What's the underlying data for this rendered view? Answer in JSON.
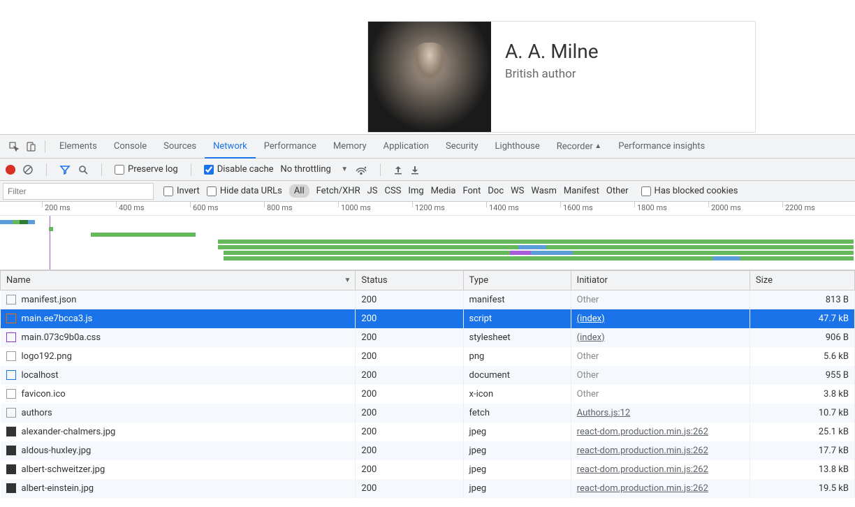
{
  "page": {
    "card_title": "A. A. Milne",
    "card_subtitle": "British author"
  },
  "devtools": {
    "tabs": [
      "Elements",
      "Console",
      "Sources",
      "Network",
      "Performance",
      "Memory",
      "Application",
      "Security",
      "Lighthouse",
      "Recorder",
      "Performance insights"
    ],
    "active_tab": "Network"
  },
  "toolbar": {
    "preserve_log": "Preserve log",
    "disable_cache": "Disable cache",
    "throttling": "No throttling"
  },
  "filter": {
    "placeholder": "Filter",
    "invert": "Invert",
    "hide_data_urls": "Hide data URLs",
    "categories": [
      "All",
      "Fetch/XHR",
      "JS",
      "CSS",
      "Img",
      "Media",
      "Font",
      "Doc",
      "WS",
      "Wasm",
      "Manifest",
      "Other"
    ],
    "active_category": "All",
    "has_blocked": "Has blocked cookies"
  },
  "timeline": {
    "ticks": [
      "200 ms",
      "400 ms",
      "600 ms",
      "800 ms",
      "1000 ms",
      "1200 ms",
      "1400 ms",
      "1600 ms",
      "1800 ms",
      "2000 ms",
      "2200 ms"
    ]
  },
  "columns": {
    "name": "Name",
    "status": "Status",
    "type": "Type",
    "initiator": "Initiator",
    "size": "Size"
  },
  "rows": [
    {
      "icon": "doc",
      "name": "manifest.json",
      "status": "200",
      "type": "manifest",
      "initiator": "Other",
      "initiator_link": false,
      "size": "813 B"
    },
    {
      "icon": "js",
      "name": "main.ee7bcca3.js",
      "status": "200",
      "type": "script",
      "initiator": "(index)",
      "initiator_link": true,
      "size": "47.7 kB",
      "selected": true
    },
    {
      "icon": "css",
      "name": "main.073c9b0a.css",
      "status": "200",
      "type": "stylesheet",
      "initiator": "(index)",
      "initiator_link": true,
      "size": "906 B"
    },
    {
      "icon": "doc",
      "name": "logo192.png",
      "status": "200",
      "type": "png",
      "initiator": "Other",
      "initiator_link": false,
      "size": "5.6 kB"
    },
    {
      "icon": "html",
      "name": "localhost",
      "status": "200",
      "type": "document",
      "initiator": "Other",
      "initiator_link": false,
      "size": "955 B"
    },
    {
      "icon": "doc",
      "name": "favicon.ico",
      "status": "200",
      "type": "x-icon",
      "initiator": "Other",
      "initiator_link": false,
      "size": "3.8 kB"
    },
    {
      "icon": "doc",
      "name": "authors",
      "status": "200",
      "type": "fetch",
      "initiator": "Authors.js:12",
      "initiator_link": true,
      "size": "10.7 kB"
    },
    {
      "icon": "img",
      "name": "alexander-chalmers.jpg",
      "status": "200",
      "type": "jpeg",
      "initiator": "react-dom.production.min.js:262",
      "initiator_link": true,
      "size": "25.1 kB"
    },
    {
      "icon": "img",
      "name": "aldous-huxley.jpg",
      "status": "200",
      "type": "jpeg",
      "initiator": "react-dom.production.min.js:262",
      "initiator_link": true,
      "size": "17.7 kB"
    },
    {
      "icon": "img",
      "name": "albert-schweitzer.jpg",
      "status": "200",
      "type": "jpeg",
      "initiator": "react-dom.production.min.js:262",
      "initiator_link": true,
      "size": "13.8 kB"
    },
    {
      "icon": "img",
      "name": "albert-einstein.jpg",
      "status": "200",
      "type": "jpeg",
      "initiator": "react-dom.production.min.js:262",
      "initiator_link": true,
      "size": "19.5 kB"
    }
  ]
}
